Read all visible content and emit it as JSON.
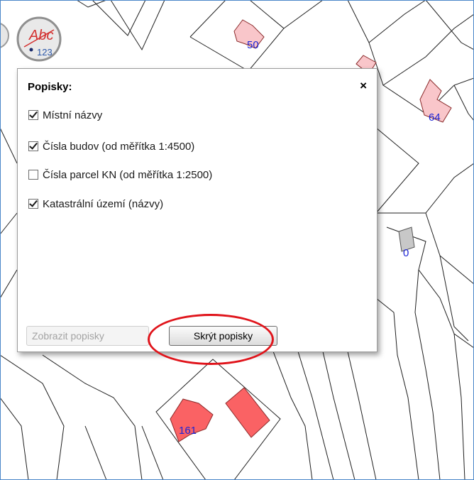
{
  "dialog": {
    "title": "Popisky:",
    "close_symbol": "×",
    "options": [
      {
        "label": "Místní názvy",
        "checked": true
      },
      {
        "label": "Čísla budov (od měřítka 1:4500)",
        "checked": true
      },
      {
        "label": "Čísla parcel KN (od měřítka 1:2500)",
        "checked": false
      },
      {
        "label": "Katastrální území (názvy)",
        "checked": true
      }
    ],
    "show_button": "Zobrazit popisky",
    "hide_button": "Skrýt popisky"
  },
  "tool_button": {
    "top_text": "Abc",
    "bottom_text": "123",
    "icon": "labels-tool-icon"
  },
  "map": {
    "building_labels": [
      "50",
      "64",
      "0",
      "161"
    ]
  },
  "colors": {
    "building_fill": "#f9c6ca",
    "building_fill_strong": "#fa6264",
    "building_fill_gray": "#c8c8c8",
    "label_color": "#1d25d6",
    "highlight": "#e0141b",
    "map_border": "#4a86c8"
  }
}
